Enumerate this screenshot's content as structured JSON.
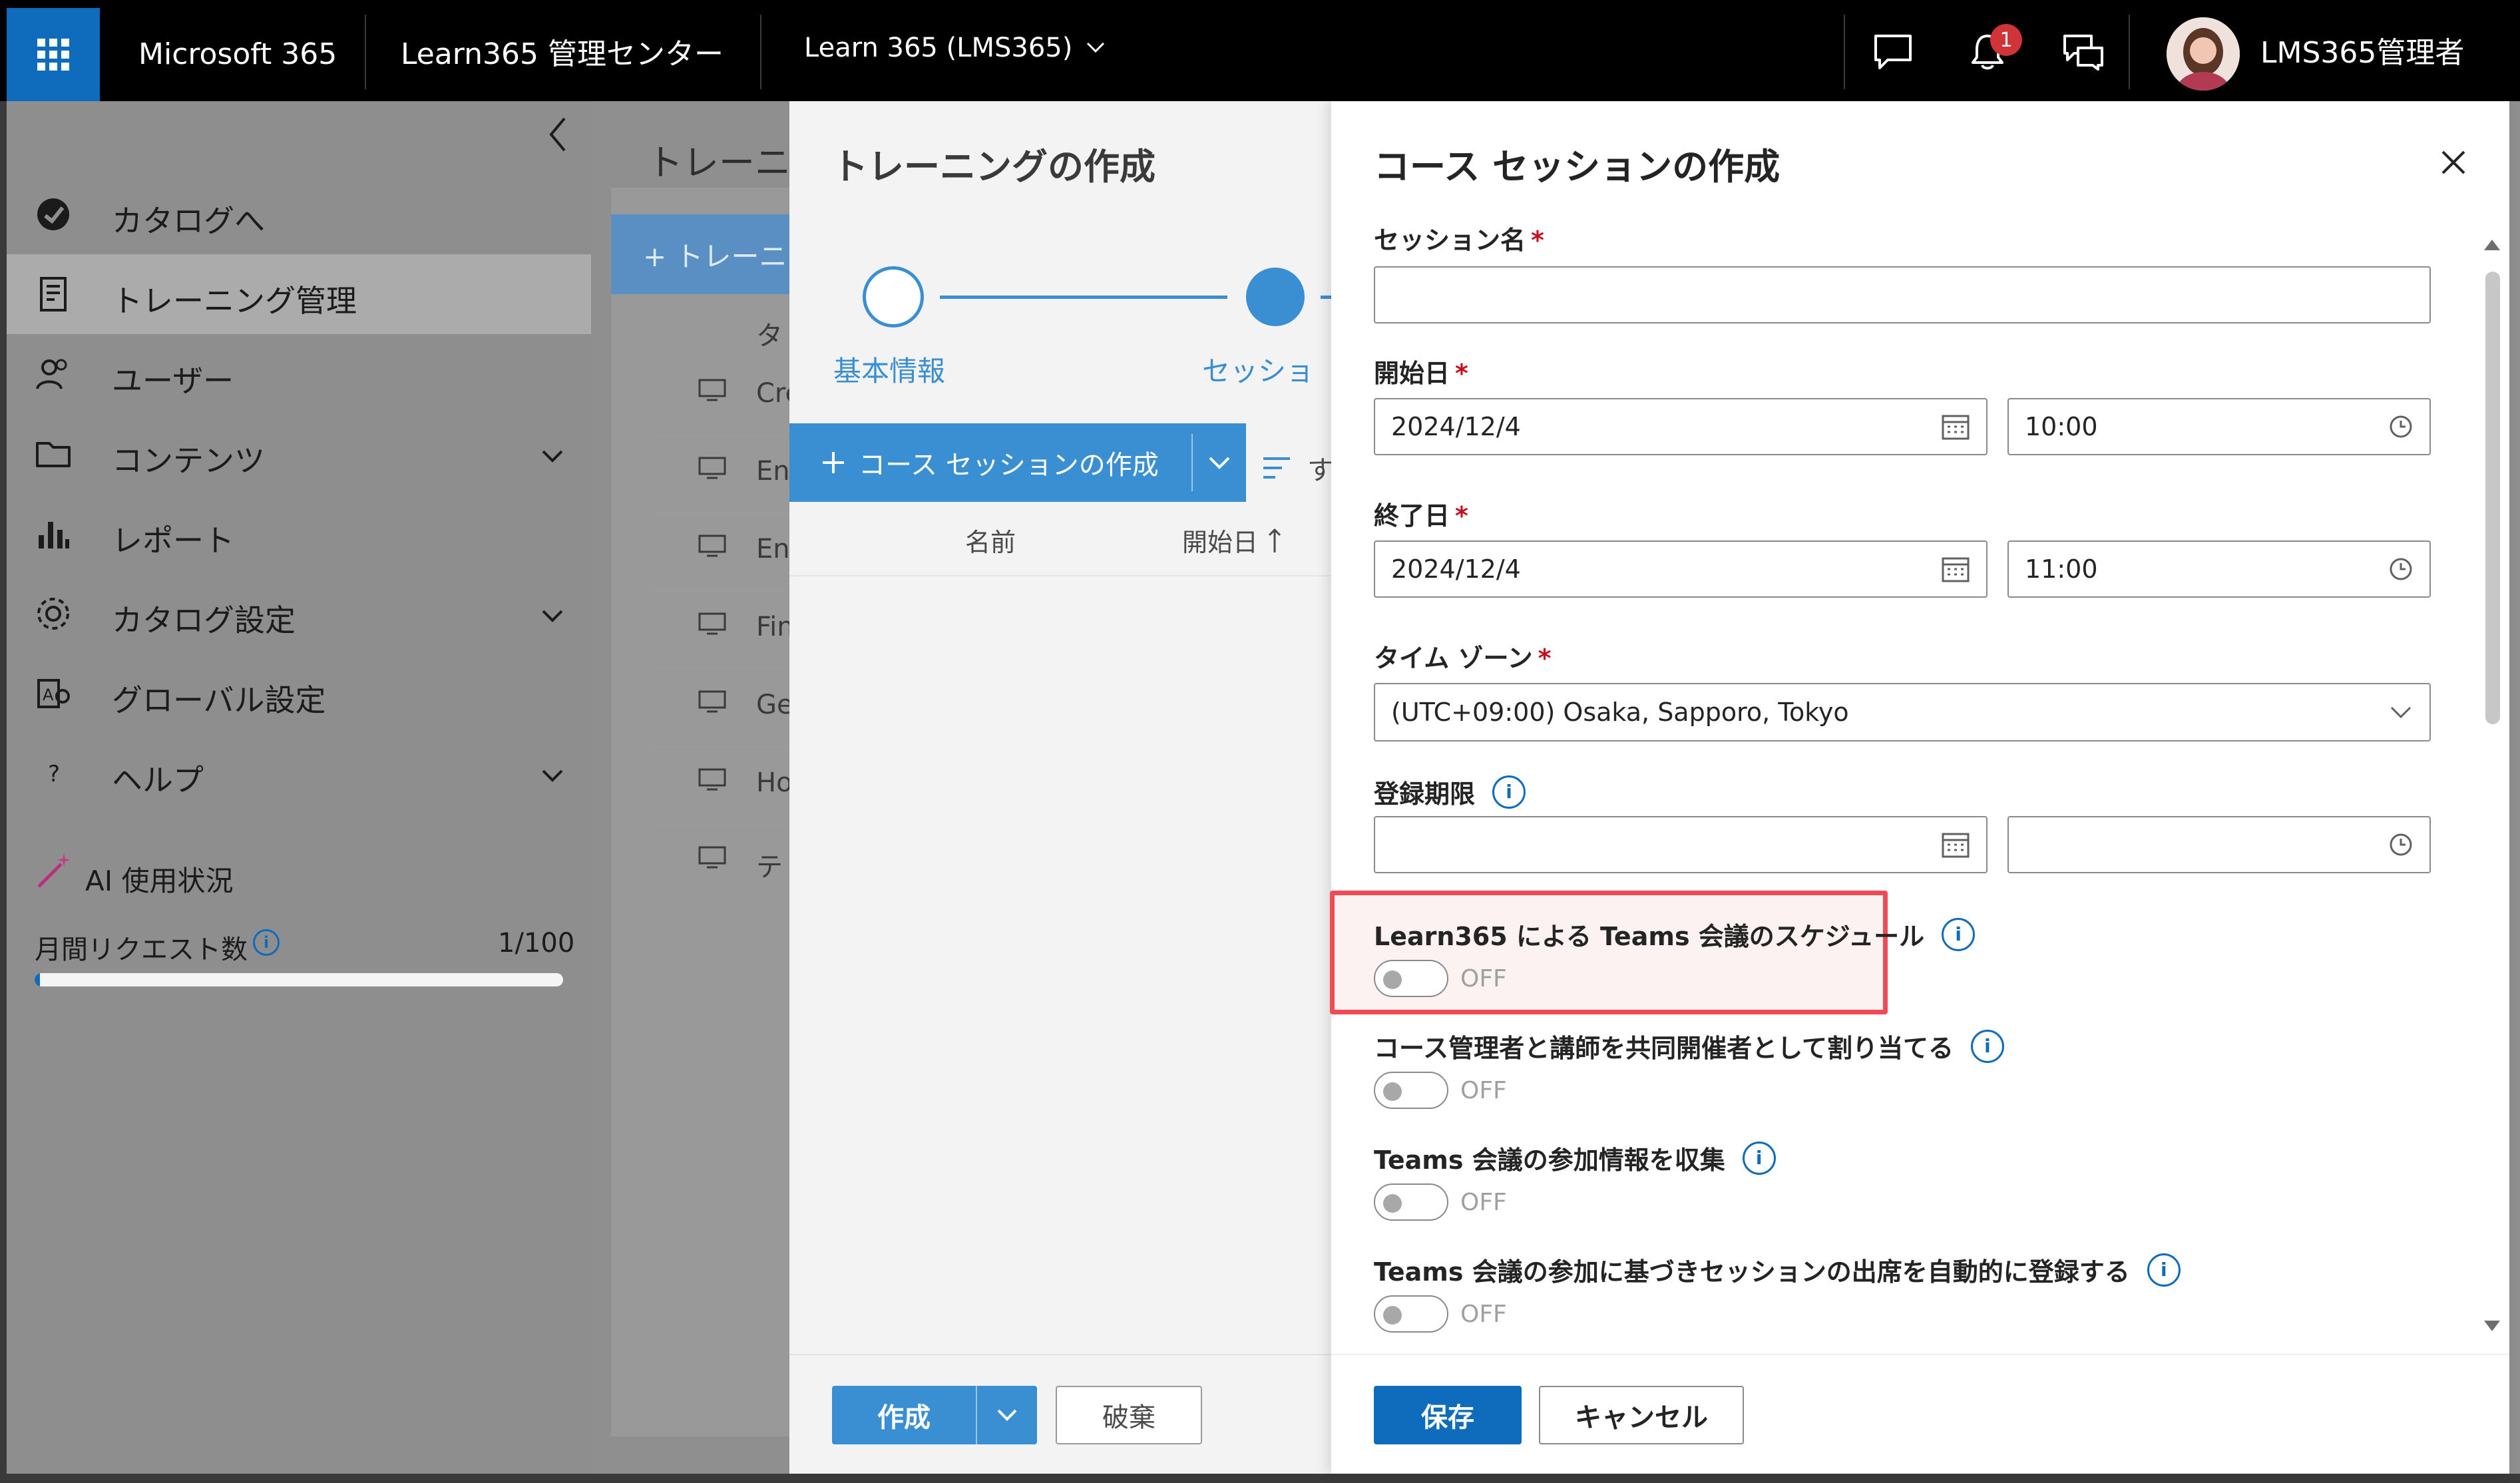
{
  "topbar": {
    "app_name": "Microsoft 365",
    "admin_center": "Learn365 管理センター",
    "tenant": "Learn 365 (LMS365)",
    "notification_count": "1",
    "user_name": "LMS365管理者"
  },
  "sidebar": {
    "items": [
      {
        "label": "カタログへ",
        "icon": "catalog-icon"
      },
      {
        "label": "トレーニング管理",
        "icon": "training-icon",
        "active": true
      },
      {
        "label": "ユーザー",
        "icon": "users-icon"
      },
      {
        "label": "コンテンツ",
        "icon": "folder-icon",
        "expandable": true
      },
      {
        "label": "レポート",
        "icon": "report-icon"
      },
      {
        "label": "カタログ設定",
        "icon": "gear-icon",
        "expandable": true
      },
      {
        "label": "グローバル設定",
        "icon": "global-settings-icon"
      },
      {
        "label": "ヘルプ",
        "icon": "help-icon",
        "expandable": true
      }
    ],
    "ai_usage_label": "AI 使用状況",
    "monthly_requests_label": "月間リクエスト数",
    "monthly_requests_value": "1/100",
    "monthly_requests_fraction": 0.01
  },
  "background_page": {
    "title": "トレーニ",
    "new_button": "+ トレーニ",
    "column_header": "タ",
    "rows": [
      "Cre",
      "Eng",
      "Eng",
      "Fin",
      "Ge",
      "Ho",
      "テ"
    ]
  },
  "wizard": {
    "title": "トレーニングの作成",
    "steps": [
      "基本情報",
      "セッショ"
    ],
    "create_session_button": "コース セッションの作成",
    "filter_label": "す",
    "col_name": "名前",
    "col_start": "開始日",
    "create_button": "作成",
    "discard_button": "破棄"
  },
  "panel": {
    "title": "コース セッションの作成",
    "session_name_label": "セッション名",
    "session_name_value": "",
    "start_label": "開始日",
    "start_date": "2024/12/4",
    "start_time": "10:00",
    "end_label": "終了日",
    "end_date": "2024/12/4",
    "end_time": "11:00",
    "timezone_label": "タイム ゾーン",
    "timezone_value": "(UTC+09:00) Osaka, Sapporo, Tokyo",
    "deadline_label": "登録期限",
    "toggles": [
      {
        "label": "Learn365 による Teams 会議のスケジュール",
        "state": "OFF"
      },
      {
        "label": "コース管理者と講師を共同開催者として割り当てる",
        "state": "OFF"
      },
      {
        "label": "Teams 会議の参加情報を収集",
        "state": "OFF"
      },
      {
        "label": "Teams 会議の参加に基づきセッションの出席を自動的に登録する",
        "state": "OFF"
      }
    ],
    "save_button": "保存",
    "cancel_button": "キャンセル"
  },
  "colors": {
    "accent": "#0f6cbd",
    "highlight": "#f04b55",
    "required": "#c50f1f"
  }
}
